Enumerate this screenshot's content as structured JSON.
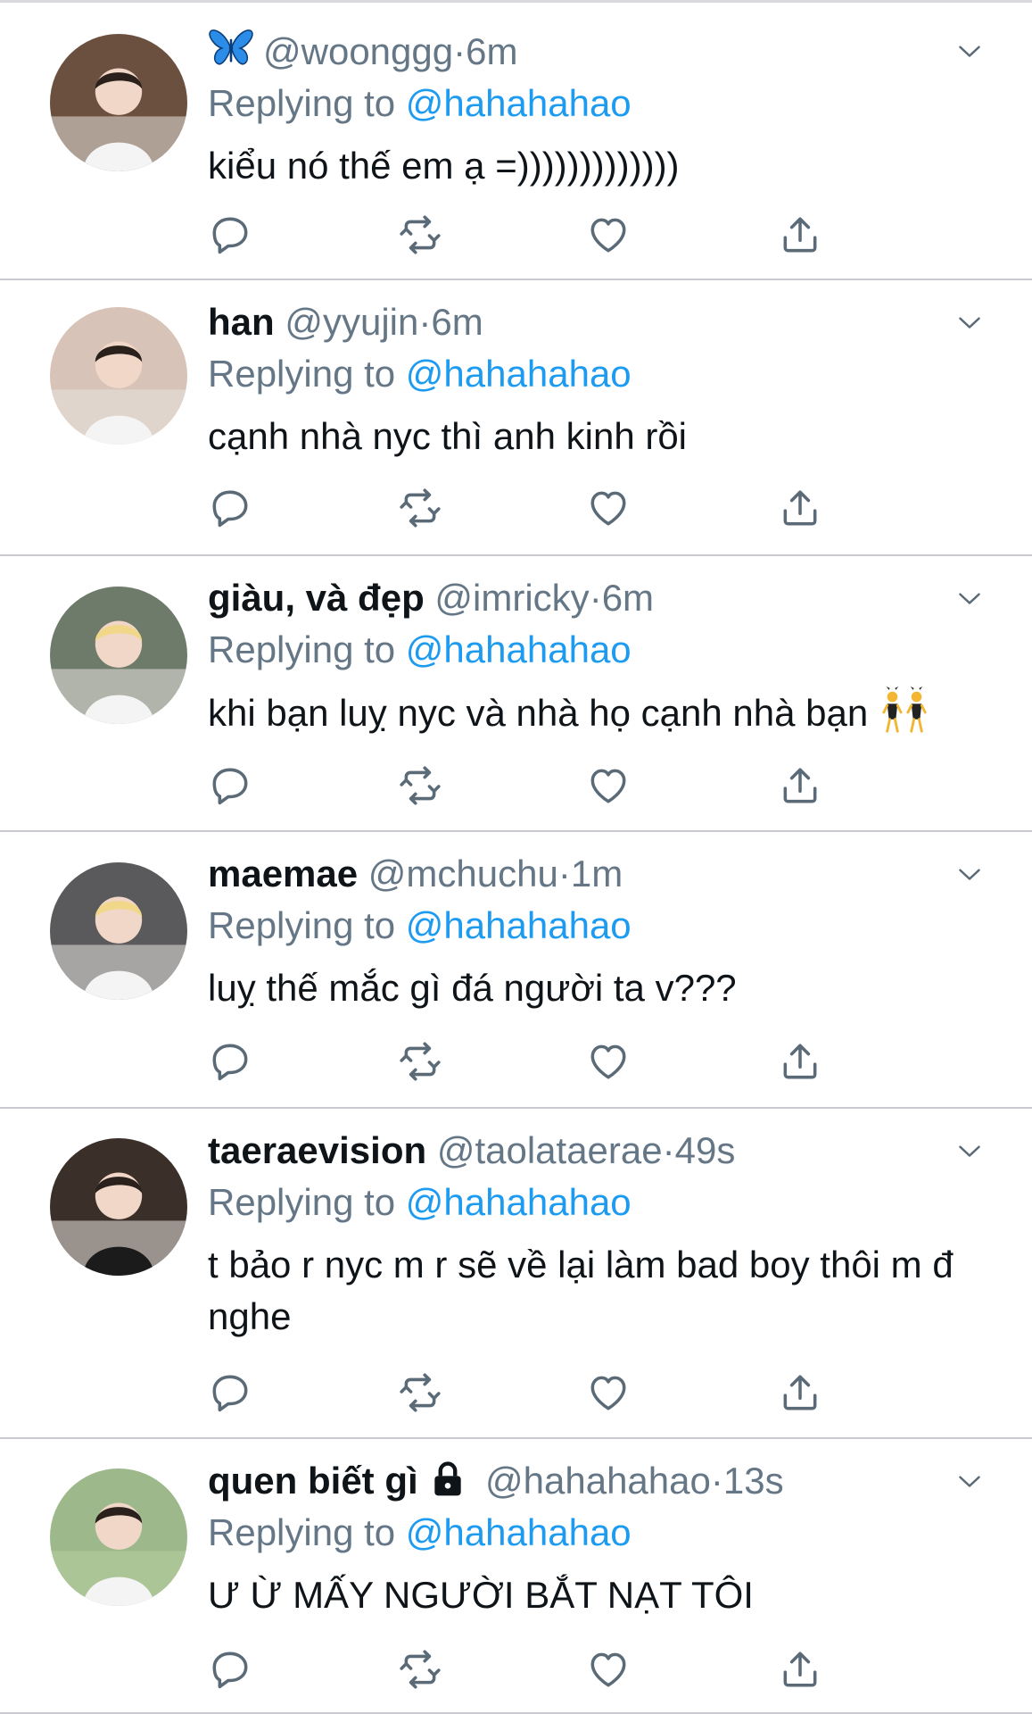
{
  "tweets": [
    {
      "display_name": "",
      "name_icon": "butterfly-icon",
      "handle": "@woonggg",
      "separator": "·",
      "time": "6m",
      "replying_label": "Replying to",
      "replying_to": "@hahahahao",
      "text": "kiểu nó thế em ạ =)))))))))))))",
      "avatar_color": "#6b4f3f"
    },
    {
      "display_name": "han",
      "handle": "@yyujin",
      "separator": "·",
      "time": "6m",
      "replying_label": "Replying to",
      "replying_to": "@hahahahao",
      "text": "cạnh nhà nyc thì anh kinh rồi",
      "avatar_color": "#d8c3b8"
    },
    {
      "display_name": "giàu, và đẹp",
      "handle": "@imricky",
      "separator": "·",
      "time": "6m",
      "replying_label": "Replying to",
      "replying_to": "@hahahahao",
      "text": "khi bạn luỵ nyc và nhà họ cạnh nhà bạn",
      "trailing_emoji": "dancers-emoji",
      "avatar_color": "#6f7b6a"
    },
    {
      "display_name": "maemae",
      "handle": "@mchuchu",
      "separator": "·",
      "time": "1m",
      "replying_label": "Replying to",
      "replying_to": "@hahahahao",
      "text": "luỵ thế mắc gì đá người ta v???",
      "avatar_color": "#5a5a5c"
    },
    {
      "display_name": "taeraevision",
      "handle": "@taolataerae",
      "separator": "·",
      "time": "49s",
      "replying_label": "Replying to",
      "replying_to": "@hahahahao",
      "text": "t bảo r nyc m r sẽ về lại làm bad boy thôi m đ nghe",
      "avatar_color": "#3b2f2a"
    },
    {
      "display_name": "quen biết gì",
      "name_icon": "lock-icon",
      "handle": "@hahahahao",
      "separator": "·",
      "time": "13s",
      "replying_label": "Replying to",
      "replying_to": "@hahahahao",
      "text": "Ư Ừ MẤY NGƯỜI BẮT NẠT TÔI",
      "avatar_color": "#9db88a"
    }
  ],
  "actions": [
    "reply-icon",
    "retweet-icon",
    "like-icon",
    "share-icon"
  ],
  "colors": {
    "link": "#1d9bf0",
    "secondary_text": "#657786",
    "primary_text": "#0f1419",
    "icon": "#5b6a77",
    "divider": "#c9c9cf"
  }
}
